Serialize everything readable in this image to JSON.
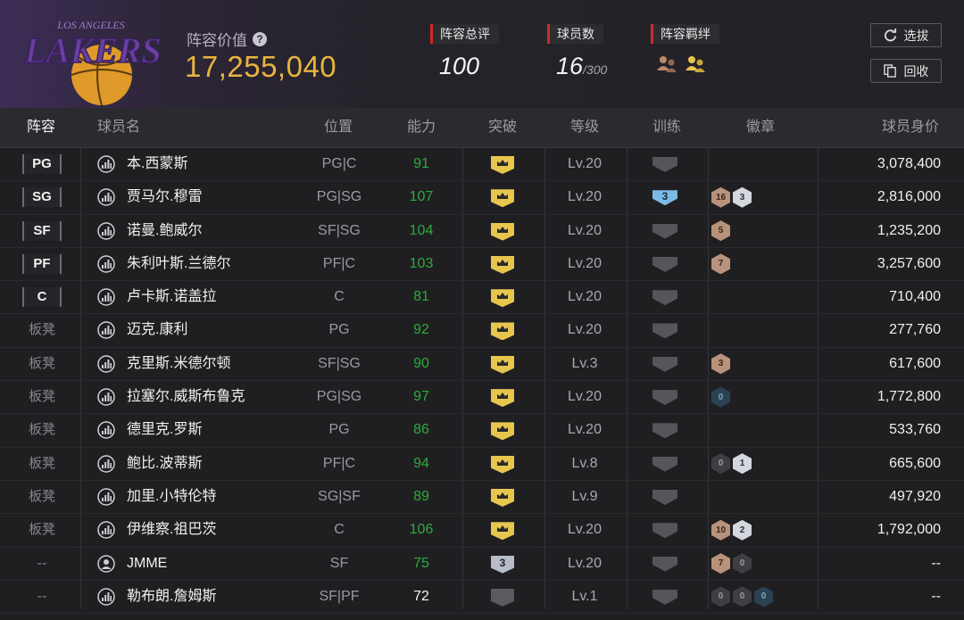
{
  "team": {
    "logo_text": "LAKERS",
    "logo_subtext": "LOS ANGELES",
    "value_label": "阵容价值",
    "value": "17,255,040"
  },
  "stats": {
    "rating_label": "阵容总评",
    "rating": "100",
    "count_label": "球员数",
    "count": "16",
    "count_max": "/300",
    "bond_label": "阵容羁绊"
  },
  "buttons": {
    "select": "选拔",
    "recycle": "回收"
  },
  "columns": [
    "阵容",
    "球员名",
    "位置",
    "能力",
    "突破",
    "等级",
    "训练",
    "徽章",
    "球员身价"
  ],
  "colors": {
    "accent_gold": "#e9b43f",
    "ability_green": "#2eaa3c",
    "stat_red": "#d02a2a"
  },
  "players": [
    {
      "slot": "PG",
      "name": "本.西蒙斯",
      "pos": "PG|C",
      "ability": "91",
      "breakthrough": "crown",
      "level": "Lv.20",
      "training": "",
      "badges": [],
      "price": "3,078,400"
    },
    {
      "slot": "SG",
      "name": "贾马尔.穆雷",
      "pos": "PG|SG",
      "ability": "107",
      "breakthrough": "crown",
      "level": "Lv.20",
      "training": "3",
      "badges": [
        {
          "t": "bronze",
          "v": "16"
        },
        {
          "t": "silver",
          "v": "3"
        }
      ],
      "price": "2,816,000"
    },
    {
      "slot": "SF",
      "name": "诺曼.鲍威尔",
      "pos": "SF|SG",
      "ability": "104",
      "breakthrough": "crown",
      "level": "Lv.20",
      "training": "",
      "badges": [
        {
          "t": "bronze",
          "v": "5"
        }
      ],
      "price": "1,235,200"
    },
    {
      "slot": "PF",
      "name": "朱利叶斯.兰德尔",
      "pos": "PF|C",
      "ability": "103",
      "breakthrough": "crown",
      "level": "Lv.20",
      "training": "",
      "badges": [
        {
          "t": "bronze",
          "v": "7"
        }
      ],
      "price": "3,257,600"
    },
    {
      "slot": "C",
      "name": "卢卡斯.诺盖拉",
      "pos": "C",
      "ability": "81",
      "breakthrough": "crown",
      "level": "Lv.20",
      "training": "",
      "badges": [],
      "price": "710,400"
    },
    {
      "slot": "板凳",
      "name": "迈克.康利",
      "pos": "PG",
      "ability": "92",
      "breakthrough": "crown",
      "level": "Lv.20",
      "training": "",
      "badges": [],
      "price": "277,760"
    },
    {
      "slot": "板凳",
      "name": "克里斯.米德尔顿",
      "pos": "SF|SG",
      "ability": "90",
      "breakthrough": "crown",
      "level": "Lv.3",
      "training": "",
      "badges": [
        {
          "t": "bronze",
          "v": "3"
        }
      ],
      "price": "617,600"
    },
    {
      "slot": "板凳",
      "name": "拉塞尔.威斯布鲁克",
      "pos": "PG|SG",
      "ability": "97",
      "breakthrough": "crown",
      "level": "Lv.20",
      "training": "",
      "badges": [
        {
          "t": "navy",
          "v": "0"
        }
      ],
      "price": "1,772,800"
    },
    {
      "slot": "板凳",
      "name": "德里克.罗斯",
      "pos": "PG",
      "ability": "86",
      "breakthrough": "crown",
      "level": "Lv.20",
      "training": "",
      "badges": [],
      "price": "533,760"
    },
    {
      "slot": "板凳",
      "name": "鲍比.波蒂斯",
      "pos": "PF|C",
      "ability": "94",
      "breakthrough": "crown",
      "level": "Lv.8",
      "training": "",
      "badges": [
        {
          "t": "dark",
          "v": "0"
        },
        {
          "t": "silver",
          "v": "1"
        }
      ],
      "price": "665,600"
    },
    {
      "slot": "板凳",
      "name": "加里.小特伦特",
      "pos": "SG|SF",
      "ability": "89",
      "breakthrough": "crown",
      "level": "Lv.9",
      "training": "",
      "badges": [],
      "price": "497,920"
    },
    {
      "slot": "板凳",
      "name": "伊维察.祖巴茨",
      "pos": "C",
      "ability": "106",
      "breakthrough": "crown",
      "level": "Lv.20",
      "training": "",
      "badges": [
        {
          "t": "bronze",
          "v": "10"
        },
        {
          "t": "silver",
          "v": "2"
        }
      ],
      "price": "1,792,000"
    },
    {
      "slot": "--",
      "name": "JMME",
      "pos": "SF",
      "ability": "75",
      "breakthrough": "num3",
      "breakthrough_value": "3",
      "level": "Lv.20",
      "training": "",
      "badges": [
        {
          "t": "bronze",
          "v": "7"
        },
        {
          "t": "dark",
          "v": "0"
        }
      ],
      "price": "--",
      "icon": "person"
    },
    {
      "slot": "--",
      "name": "勒布朗.詹姆斯",
      "pos": "SF|PF",
      "ability": "72",
      "ability_white": true,
      "breakthrough": "gray",
      "level": "Lv.1",
      "training": "",
      "badges": [
        {
          "t": "dark",
          "v": "0"
        },
        {
          "t": "dark",
          "v": "0"
        },
        {
          "t": "navy",
          "v": "0"
        }
      ],
      "price": "--"
    }
  ]
}
